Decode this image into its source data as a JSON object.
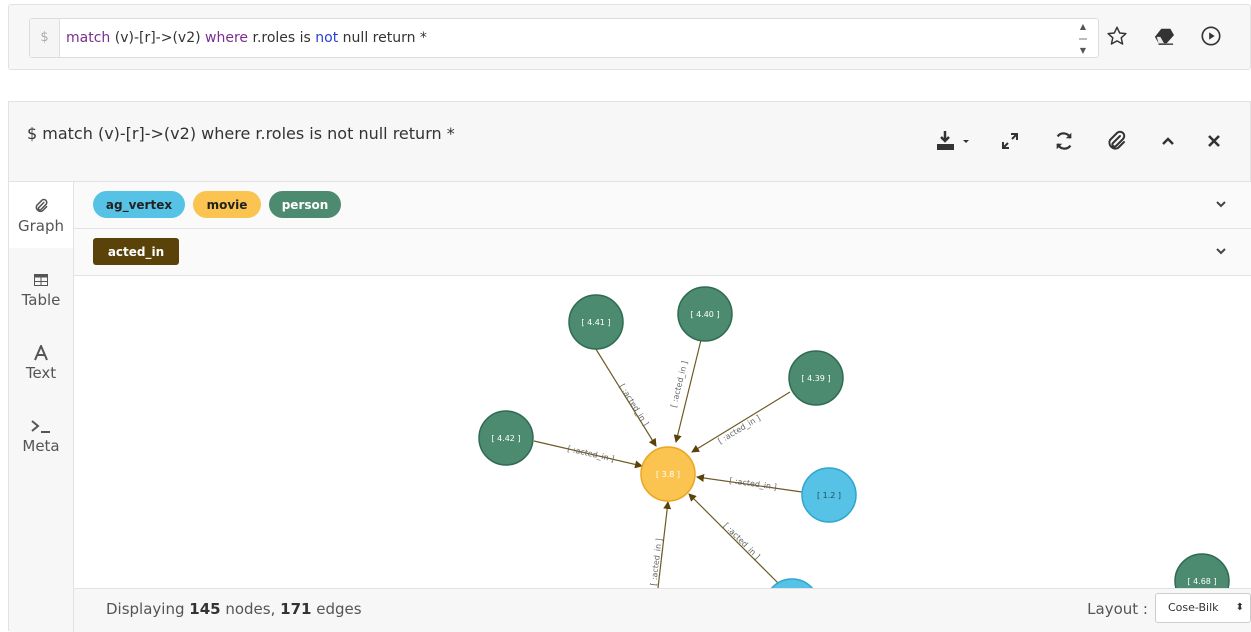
{
  "query_bar": {
    "prompt": "$",
    "query_parts": {
      "p1": "match",
      "p2": " (v)-[r]->(v2) ",
      "p3": "where",
      "p4": " r.roles is ",
      "p5": "not",
      "p6": " null return *"
    },
    "icons": [
      "star-icon",
      "eraser-icon",
      "play-icon"
    ]
  },
  "frame": {
    "title": "$ match (v)-[r]->(v2) where r.roles is not null return *",
    "header_icons": [
      "download-icon",
      "expand-icon",
      "refresh-icon",
      "paperclip-icon",
      "chevron-up-icon",
      "close-icon"
    ]
  },
  "side_tabs": [
    {
      "label": "Graph",
      "icon": "paperclip-icon",
      "active": true
    },
    {
      "label": "Table",
      "icon": "table-icon"
    },
    {
      "label": "Text",
      "icon": "text-a-icon"
    },
    {
      "label": "Meta",
      "icon": "terminal-icon"
    }
  ],
  "legend": {
    "node_labels": [
      {
        "label": "ag_vertex",
        "color": "#56c3e6"
      },
      {
        "label": "movie",
        "color": "#fbc350"
      },
      {
        "label": "person",
        "color": "#4d8b70"
      }
    ],
    "edge_labels": [
      {
        "label": "acted_in",
        "color": "#5b4209"
      }
    ]
  },
  "graph": {
    "nodes": {
      "center": "[ 3.8 ]",
      "n441": "[ 4.41 ]",
      "n440": "[ 4.40 ]",
      "n439": "[ 4.39 ]",
      "n442": "[ 4.42 ]",
      "n12": "[ 1.2 ]",
      "n468": "[ 4.68 ]"
    },
    "edge_label": "[ :acted_in ]",
    "colors": {
      "person": "#4d8b70",
      "movie": "#fbc350",
      "ag_vertex": "#56c3e6",
      "edge": "#7a6a3a"
    }
  },
  "footer": {
    "prefix": "Displaying ",
    "node_count": "145",
    "mid": " nodes, ",
    "edge_count": "171",
    "suffix": " edges",
    "layout_label": "Layout :",
    "layout_value": "Cose-Bilk"
  }
}
